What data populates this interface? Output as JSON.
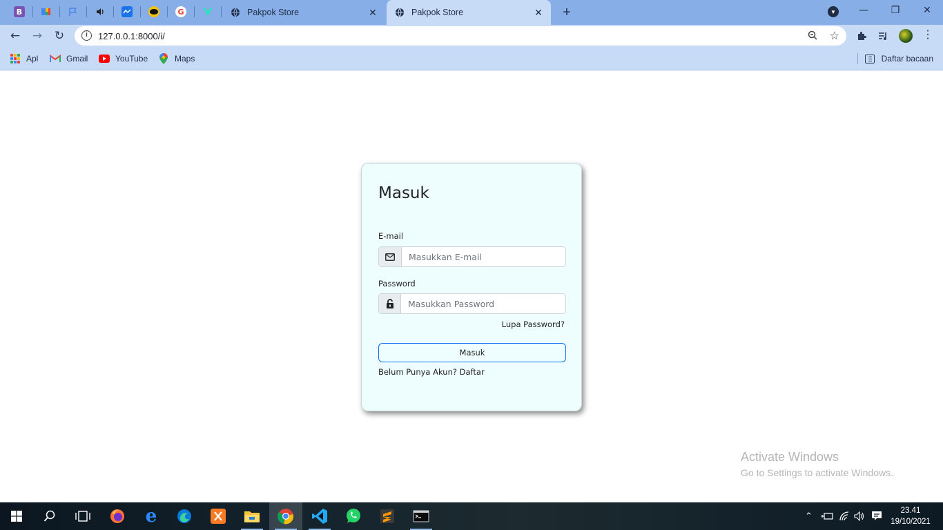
{
  "browser": {
    "pinned_tabs": [
      {
        "icon": "bootstrap-icon",
        "glyph": "B",
        "color": "#7952b3"
      },
      {
        "icon": "colorful-grid-icon",
        "glyph": "▦",
        "color": "#4285f4"
      },
      {
        "icon": "flag-icon",
        "glyph": "⚐",
        "color": "#4a86e8"
      },
      {
        "icon": "speaker-icon",
        "glyph": "◂",
        "color": "#333333"
      },
      {
        "icon": "chart-icon",
        "glyph": "≈",
        "color": "#1a73e8"
      },
      {
        "icon": "batman-icon",
        "glyph": "✪",
        "color": "#f4c20d"
      },
      {
        "icon": "google-icon",
        "glyph": "G",
        "color": "#ea4335"
      },
      {
        "icon": "vuetify-icon",
        "glyph": "▽",
        "color": "#1de9b6"
      }
    ],
    "tabs": [
      {
        "title": "Pakpok Store",
        "active": false
      },
      {
        "title": "Pakpok Store",
        "active": true
      }
    ],
    "url": "127.0.0.1:8000/i/",
    "bookmarks": [
      {
        "label": "Apl",
        "icon": "apps-grid-icon"
      },
      {
        "label": "Gmail",
        "icon": "gmail-icon"
      },
      {
        "label": "YouTube",
        "icon": "youtube-icon"
      },
      {
        "label": "Maps",
        "icon": "maps-icon"
      }
    ],
    "reading_list": "Daftar bacaan"
  },
  "login": {
    "title": "Masuk",
    "email_label": "E-mail",
    "email_placeholder": "Masukkan E-mail",
    "password_label": "Password",
    "password_placeholder": "Masukkan Password",
    "forgot": "Lupa Password?",
    "submit": "Masuk",
    "signup": "Belum Punya Akun? Daftar"
  },
  "watermark": {
    "line1": "Activate Windows",
    "line2": "Go to Settings to activate Windows."
  },
  "taskbar": {
    "time": "23.41",
    "date": "19/10/2021"
  },
  "colors": {
    "tabstrip": "#88aee8",
    "toolbar": "#c7dbf7",
    "card_bg": "#eefdfe",
    "button_border": "#0d6efd"
  }
}
